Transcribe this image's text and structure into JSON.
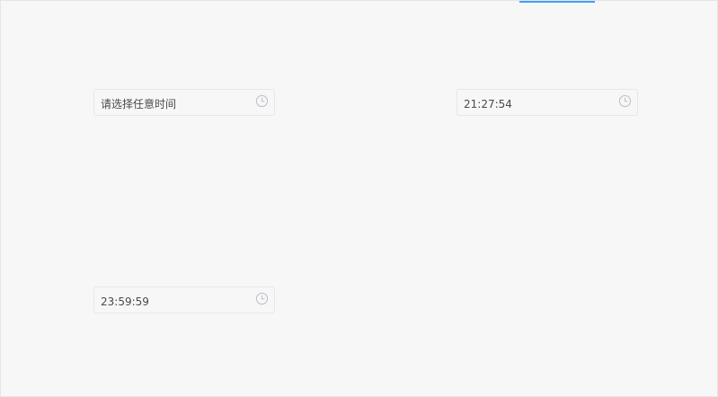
{
  "pickers": [
    {
      "text": "请选择任意时间",
      "icon": "clock-icon"
    },
    {
      "text": "21:27:54",
      "icon": "clock-icon"
    },
    {
      "text": "23:59:59",
      "icon": "clock-icon"
    }
  ],
  "colors": {
    "accent": "#409eff",
    "border": "#e4e7ed",
    "background": "#f7f7f7",
    "text": "#4a4a4a",
    "icon": "#c0c4cc"
  }
}
